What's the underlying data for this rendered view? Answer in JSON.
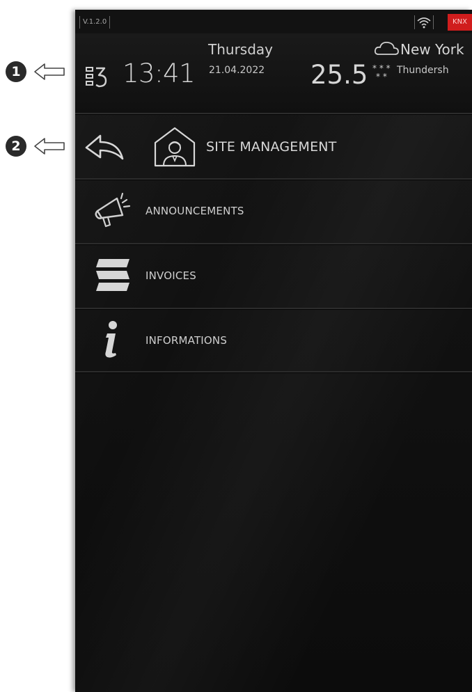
{
  "callouts": [
    {
      "number": "1"
    },
    {
      "number": "2"
    }
  ],
  "status_bar": {
    "version": "V.1.2.0",
    "wifi_icon": "wifi-icon",
    "protocol_badge": "KNX",
    "badge_color": "#d01d1d"
  },
  "header": {
    "time": "13:41",
    "day": "Thursday",
    "date": "21.04.2022",
    "temperature": "25.5",
    "city": "New York",
    "condition": "Thundersh"
  },
  "page": {
    "title": "SITE MANAGEMENT"
  },
  "menu": {
    "items": [
      {
        "label": "ANNOUNCEMENTS",
        "icon": "megaphone-icon"
      },
      {
        "label": "INVOICES",
        "icon": "invoice-stack-icon"
      },
      {
        "label": "INFORMATIONS",
        "icon": "info-icon"
      }
    ]
  },
  "colors": {
    "screen_bg": "#0e0e0e",
    "text": "#d6d6d6"
  }
}
